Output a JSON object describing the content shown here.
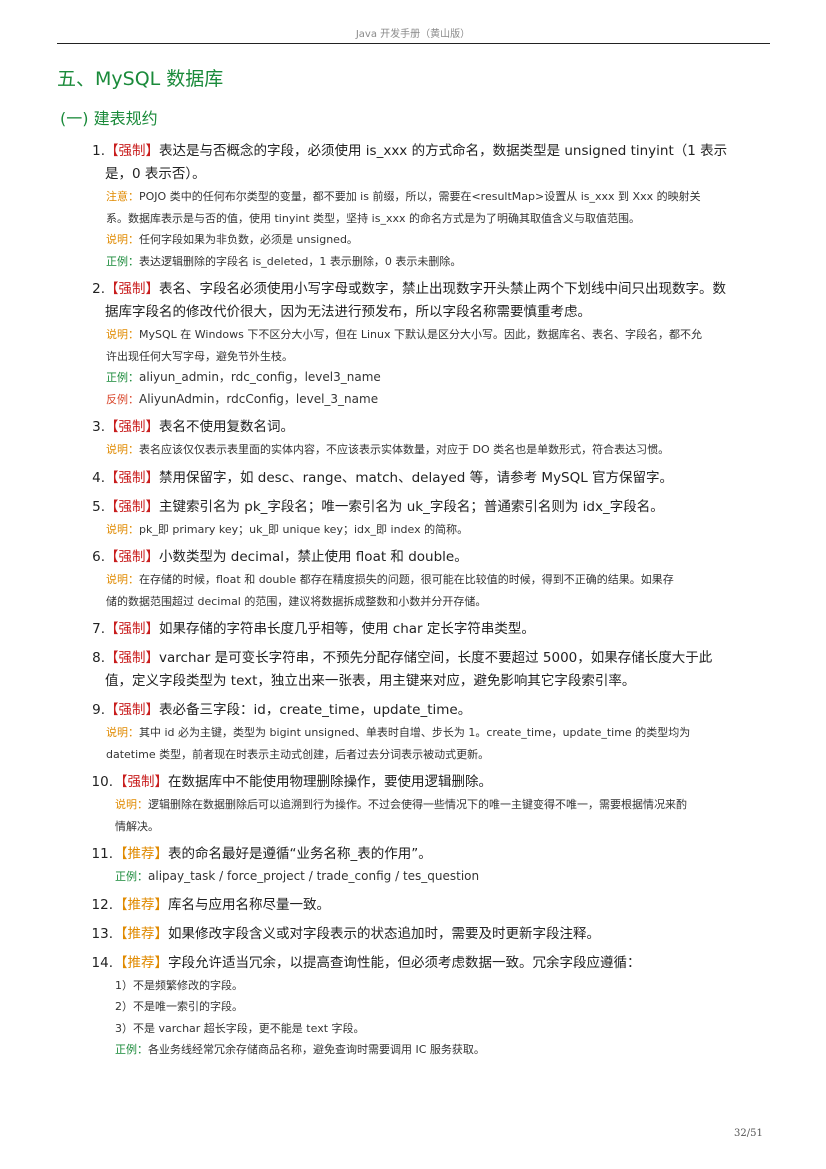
{
  "header": {
    "title": "Java 开发手册（黄山版）"
  },
  "section": {
    "title": "五、MySQL 数据库"
  },
  "subsection": {
    "title": "(一) 建表规约"
  },
  "labels": {
    "strong": "【强制】",
    "recommend": "【推荐】",
    "note": "注意：",
    "explain": "说明：",
    "positive": "正例：",
    "negative": "反例："
  },
  "rules": [
    {
      "num": "1.",
      "lines": [
        "表达是与否概念的字段，必须使用 is_xxx 的方式命名，数据类型是 unsigned tinyint（1 表示",
        "是，0 表示否）。"
      ],
      "note": [
        "POJO 类中的任何布尔类型的变量，都不要加 is 前缀，所以，需要在<resultMap>设置从 is_xxx 到 Xxx 的映射关",
        "系。数据库表示是与否的值，使用 tinyint 类型，坚持 is_xxx 的命名方式是为了明确其取值含义与取值范围。"
      ],
      "explain": "任何字段如果为非负数，必须是 unsigned。",
      "positive": "表达逻辑删除的字段名 is_deleted，1 表示删除，0 表示未删除。"
    },
    {
      "num": "2.",
      "lines": [
        "表名、字段名必须使用小写字母或数字，禁止出现数字开头禁止两个下划线中间只出现数字。数",
        "据库字段名的修改代价很大，因为无法进行预发布，所以字段名称需要慎重考虑。"
      ],
      "explain": [
        "MySQL 在 Windows 下不区分大小写，但在 Linux 下默认是区分大小写。因此，数据库名、表名、字段名，都不允",
        "许出现任何大写字母，避免节外生枝。"
      ],
      "positive": "aliyun_admin，rdc_config，level3_name",
      "negative": "AliyunAdmin，rdcConfig，level_3_name"
    },
    {
      "num": "3.",
      "text": "表名不使用复数名词。",
      "explain": "表名应该仅仅表示表里面的实体内容，不应该表示实体数量，对应于 DO 类名也是单数形式，符合表达习惯。"
    },
    {
      "num": "4.",
      "text": "禁用保留字，如 desc、range、match、delayed 等，请参考 MySQL 官方保留字。"
    },
    {
      "num": "5.",
      "text": "主键索引名为 pk_字段名；唯一索引名为 uk_字段名；普通索引名则为 idx_字段名。",
      "explain": "pk_即 primary key；uk_即 unique key；idx_即 index 的简称。"
    },
    {
      "num": "6.",
      "text": "小数类型为 decimal，禁止使用 float 和 double。",
      "explain": [
        "在存储的时候，float 和 double 都存在精度损失的问题，很可能在比较值的时候，得到不正确的结果。如果存",
        "储的数据范围超过 decimal 的范围，建议将数据拆成整数和小数并分开存储。"
      ]
    },
    {
      "num": "7.",
      "text": "如果存储的字符串长度几乎相等，使用 char 定长字符串类型。"
    },
    {
      "num": "8.",
      "lines": [
        "varchar 是可变长字符串，不预先分配存储空间，长度不要超过 5000，如果存储长度大于此",
        "值，定义字段类型为 text，独立出来一张表，用主键来对应，避免影响其它字段索引率。"
      ]
    },
    {
      "num": "9.",
      "text": "表必备三字段：id，create_time，update_time。",
      "explain": [
        "其中 id 必为主键，类型为 bigint unsigned、单表时自增、步长为 1。create_time，update_time 的类型均为",
        "datetime 类型，前者现在时表示主动式创建，后者过去分词表示被动式更新。"
      ]
    },
    {
      "num": "10.",
      "text": "在数据库中不能使用物理删除操作，要使用逻辑删除。",
      "explain": [
        "逻辑删除在数据删除后可以追溯到行为操作。不过会使得一些情况下的唯一主键变得不唯一，需要根据情况来酌",
        "情解决。"
      ]
    },
    {
      "num": "11.",
      "text": "表的命名最好是遵循“业务名称_表的作用”。",
      "positive": "alipay_task / force_project / trade_config / tes_question"
    },
    {
      "num": "12.",
      "text": "库名与应用名称尽量一致。"
    },
    {
      "num": "13.",
      "text": "如果修改字段含义或对字段表示的状态追加时，需要及时更新字段注释。"
    },
    {
      "num": "14.",
      "text": "字段允许适当冗余，以提高查询性能，但必须考虑数据一致。冗余字段应遵循：",
      "items": [
        "1）不是频繁修改的字段。",
        "2）不是唯一索引的字段。",
        "3）不是 varchar 超长字段，更不能是 text 字段。"
      ],
      "positive": "各业务线经常冗余存储商品名称，避免查询时需要调用 IC 服务获取。"
    }
  ],
  "page_number": "32/51"
}
